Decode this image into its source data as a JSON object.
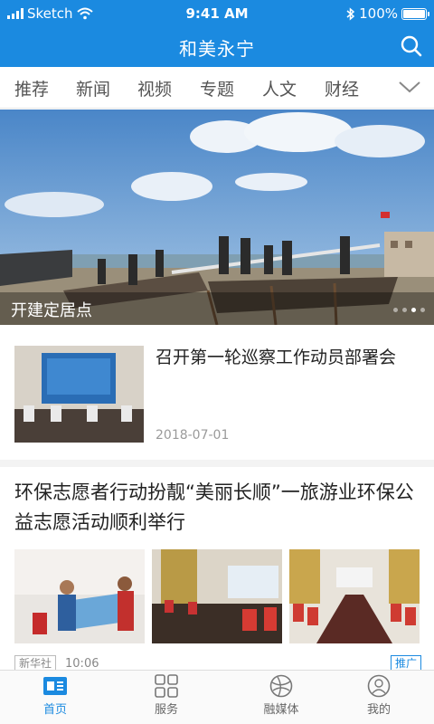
{
  "status_bar": {
    "carrier": "Sketch",
    "time": "9:41 AM",
    "battery_text": "100%",
    "battery_level": 1.0
  },
  "header": {
    "title": "和美永宁",
    "search_icon": "search-icon"
  },
  "tabs": [
    {
      "label": "推荐",
      "active": true
    },
    {
      "label": "新闻",
      "active": false
    },
    {
      "label": "视频",
      "active": false
    },
    {
      "label": "专题",
      "active": false
    },
    {
      "label": "人文",
      "active": false
    },
    {
      "label": "财经",
      "active": false
    }
  ],
  "hero": {
    "caption": "开建定居点",
    "slide_count": 4,
    "active_slide": 3
  },
  "news": [
    {
      "title": "召开第一轮巡察工作动员部署会",
      "date": "2018-07-01"
    },
    {
      "title": "环保志愿者行动扮靓“美丽长顺”一旅游业环保公益志愿活动顺利举行",
      "source": "新华社",
      "time": "10:06",
      "tag": "推广"
    }
  ],
  "bottom_nav": [
    {
      "label": "首页",
      "icon": "home-news-icon",
      "active": true
    },
    {
      "label": "服务",
      "icon": "grid-icon",
      "active": false
    },
    {
      "label": "融媒体",
      "icon": "globe-icon",
      "active": false
    },
    {
      "label": "我的",
      "icon": "user-icon",
      "active": false
    }
  ],
  "colors": {
    "brand": "#1b8ae0",
    "text": "#222222",
    "muted": "#9a9a9a"
  }
}
